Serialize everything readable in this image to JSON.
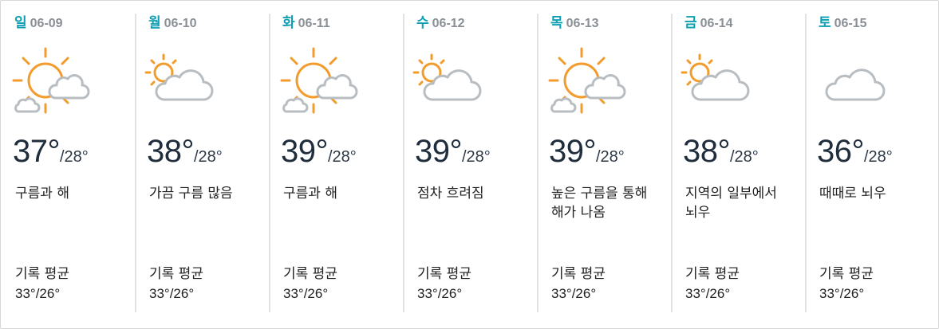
{
  "forecast": {
    "days": [
      {
        "dow": "일",
        "date": "06-09",
        "icon": "sun-cloud-icon",
        "high": "37°",
        "low": "/28°",
        "desc": "구름과 해",
        "record_label": "기록 평균",
        "record_value": "33°/26°"
      },
      {
        "dow": "월",
        "date": "06-10",
        "icon": "partly-cloudy-icon",
        "high": "38°",
        "low": "/28°",
        "desc": "가끔 구름 많음",
        "record_label": "기록 평균",
        "record_value": "33°/26°"
      },
      {
        "dow": "화",
        "date": "06-11",
        "icon": "sun-cloud-icon",
        "high": "39°",
        "low": "/28°",
        "desc": "구름과 해",
        "record_label": "기록 평균",
        "record_value": "33°/26°"
      },
      {
        "dow": "수",
        "date": "06-12",
        "icon": "partly-cloudy-icon",
        "high": "39°",
        "low": "/28°",
        "desc": "점차 흐려짐",
        "record_label": "기록 평균",
        "record_value": "33°/26°"
      },
      {
        "dow": "목",
        "date": "06-13",
        "icon": "sun-cloud-icon",
        "high": "39°",
        "low": "/28°",
        "desc": "높은 구름을 통해 해가 나옴",
        "record_label": "기록 평균",
        "record_value": "33°/26°"
      },
      {
        "dow": "금",
        "date": "06-14",
        "icon": "partly-cloudy-icon",
        "high": "38°",
        "low": "/28°",
        "desc": "지역의 일부에서 뇌우",
        "record_label": "기록 평균",
        "record_value": "33°/26°"
      },
      {
        "dow": "토",
        "date": "06-15",
        "icon": "cloud-icon",
        "high": "36°",
        "low": "/28°",
        "desc": "때때로 뇌우",
        "record_label": "기록 평균",
        "record_value": "33°/26°"
      }
    ]
  },
  "colors": {
    "accent": "#0e9fb3",
    "sun": "#f39c2e",
    "cloud": "#b8bdc2",
    "text": "#1f2d3d"
  }
}
